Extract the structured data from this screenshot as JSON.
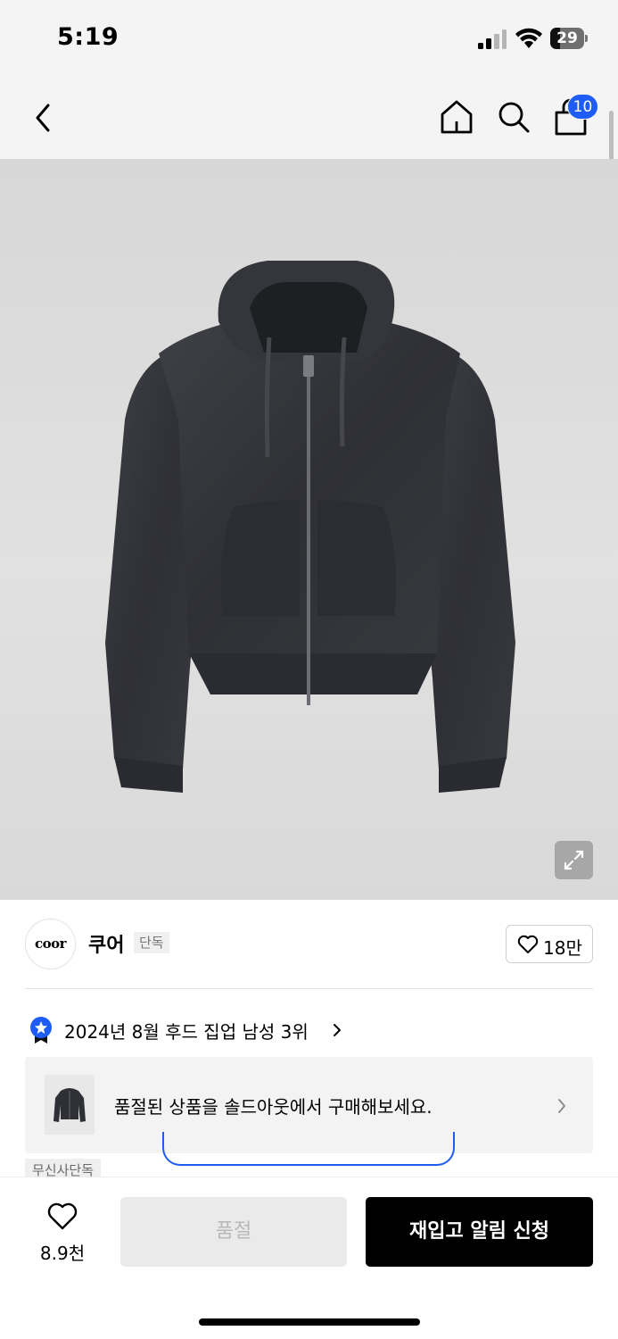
{
  "status_bar": {
    "time": "5:19",
    "battery": "29",
    "icons": [
      "signal-icon",
      "wifi-icon",
      "battery-icon"
    ]
  },
  "nav": {
    "icons": [
      "back-icon",
      "home-icon",
      "search-icon",
      "bag-icon"
    ],
    "cart_badge": "10"
  },
  "product": {
    "image": "dark-gray-zip-up-hoodie",
    "expand_icon": "expand-icon"
  },
  "brand": {
    "logo_text": "coor",
    "name": "쿠어",
    "tag": "단독",
    "likes": "18만"
  },
  "ranking": {
    "text": "2024년 8월 후드 집업 남성 3위"
  },
  "soldout_banner": {
    "text": "품절된 상품을 솔드아웃에서 구매해보세요."
  },
  "peek": {
    "tag": "무신사단독"
  },
  "bottom_bar": {
    "wish_count": "8.9천",
    "soldout_label": "품절",
    "restock_label": "재입고 알림 신청"
  },
  "colors": {
    "accent": "#1d5cf5",
    "cta": "#000000",
    "disabled_bg": "#eaeaea",
    "nav_bg": "#f4f4f4"
  }
}
